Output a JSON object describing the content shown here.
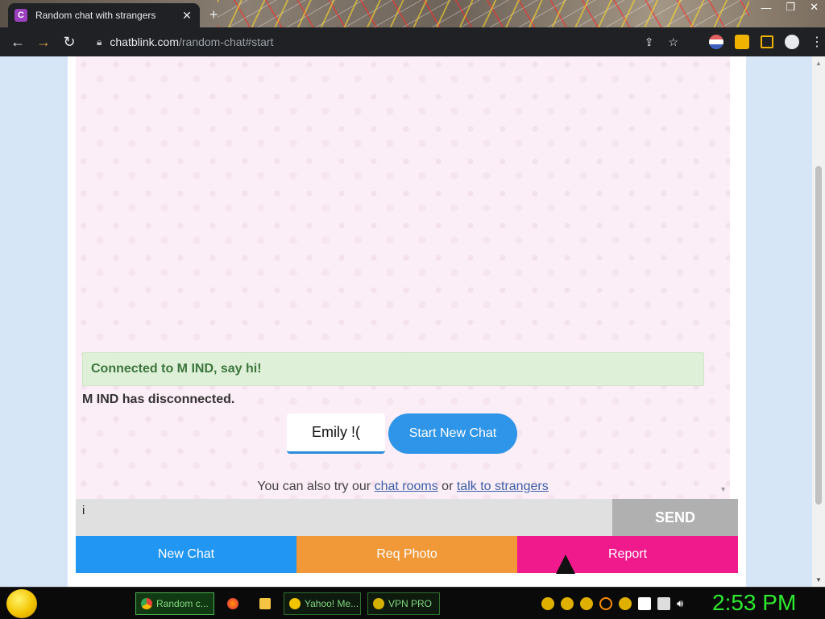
{
  "browser": {
    "tab_title": "Random chat with strangers",
    "favicon_letter": "C",
    "tab_close": "✕",
    "new_tab": "+",
    "url_host": "chatblink.com",
    "url_path": "/random-chat#start"
  },
  "chat": {
    "connected_message": "Connected to M IND, say hi!",
    "disconnected_message": "M IND has disconnected.",
    "name_button": "Emily !(",
    "start_button": "Start New Chat",
    "also_try_prefix": "You can also try our",
    "chat_rooms_link": "chat rooms",
    "or_text": "or",
    "talk_link": "talk to strangers",
    "message_input_value": "i",
    "send_label": "SEND"
  },
  "actions": {
    "new_chat": "New Chat",
    "req_photo": "Req Photo",
    "report": "Report"
  },
  "taskbar": {
    "chrome_task": "Random c...",
    "yahoo_task": "Yahoo! Me...",
    "vpn_task": "VPN PRO",
    "clock": "2:53 PM"
  },
  "colors": {
    "new_chat": "#2196f3",
    "req_photo": "#f19839",
    "report": "#f01a8c",
    "start_button": "#2f95e8",
    "connected_bg": "#dff0d8",
    "clock": "#2eea2e"
  },
  "icons": [
    "back-icon",
    "forward-icon",
    "reload-icon",
    "lock-icon",
    "share-icon",
    "star-icon",
    "extension-icon",
    "sidepanel-icon",
    "profile-icon",
    "menu-icon"
  ]
}
